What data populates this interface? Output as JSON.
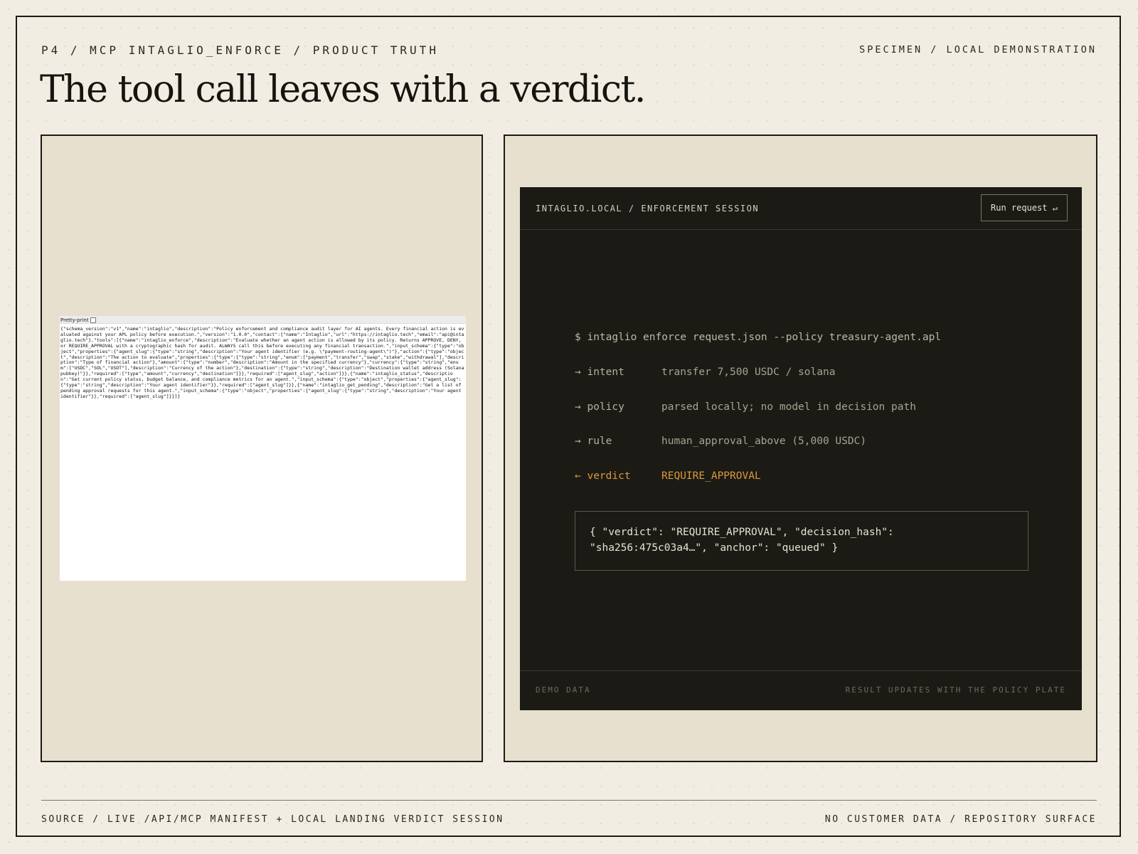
{
  "header": {
    "breadcrumb": "P4 / MCP INTAGLIO_ENFORCE / PRODUCT TRUTH",
    "tag": "SPECIMEN / LOCAL DEMONSTRATION",
    "title": "The tool call leaves with a verdict."
  },
  "manifest_view": {
    "pretty_print_label": "Pretty-print",
    "pretty_print_checked": false,
    "json_text": "{\"schema_version\":\"v1\",\"name\":\"intaglio\",\"description\":\"Policy enforcement and compliance audit layer for AI agents. Every financial action is evaluated against your APL policy before execution.\",\"version\":\"1.0.0\",\"contact\":{\"name\":\"Intaglio\",\"url\":\"https://intaglio.tech\",\"email\":\"api@intaglio.tech\"},\"tools\":[{\"name\":\"intaglio_enforce\",\"description\":\"Evaluate whether an agent action is allowed by its policy. Returns APPROVE, DENY, or REQUIRE_APPROVAL with a cryptographic hash for audit. ALWAYS call this before executing any financial transaction.\",\"input_schema\":{\"type\":\"object\",\"properties\":{\"agent_slug\":{\"type\":\"string\",\"description\":\"Your agent identifier (e.g. \\\"payment-routing-agent\\\")\"},\"action\":{\"type\":\"object\",\"description\":\"The action to evaluate\",\"properties\":{\"type\":{\"type\":\"string\",\"enum\":[\"payment\",\"transfer\",\"swap\",\"stake\",\"withdrawal\"],\"description\":\"Type of financial action\"},\"amount\":{\"type\":\"number\",\"description\":\"Amount in the specified currency\"},\"currency\":{\"type\":\"string\",\"enum\":[\"USDC\",\"SOL\",\"USDT\"],\"description\":\"Currency of the action\"},\"destination\":{\"type\":\"string\",\"description\":\"Destination wallet address (Solana pubkey)\"}},\"required\":[\"type\",\"amount\",\"currency\",\"destination\"]}},\"required\":[\"agent_slug\",\"action\"]}},{\"name\":\"intaglio_status\",\"description\":\"Get current policy status, budget balance, and compliance metrics for an agent.\",\"input_schema\":{\"type\":\"object\",\"properties\":{\"agent_slug\":{\"type\":\"string\",\"description\":\"Your agent identifier\"}},\"required\":[\"agent_slug\"]}},{\"name\":\"intaglio_get_pending\",\"description\":\"Get a list of pending approval requests for this agent.\",\"input_schema\":{\"type\":\"object\",\"properties\":{\"agent_slug\":{\"type\":\"string\",\"description\":\"Your agent identifier\"}},\"required\":[\"agent_slug\"]}}]}"
  },
  "terminal": {
    "title": "INTAGLIO.LOCAL / ENFORCEMENT SESSION",
    "run_button": "Run request ↵",
    "command": "$ intaglio enforce request.json --policy treasury-agent.apl",
    "rows": [
      {
        "key": "→ intent",
        "value": "transfer 7,500 USDC / solana"
      },
      {
        "key": "→ policy",
        "value": "parsed locally; no model in decision path"
      },
      {
        "key": "→ rule",
        "value": "human_approval_above (5,000 USDC)"
      },
      {
        "key": "← verdict",
        "value": "REQUIRE_APPROVAL"
      }
    ],
    "result": "{ \"verdict\": \"REQUIRE_APPROVAL\", \"decision_hash\": \"sha256:475c03a4…\", \"anchor\": \"queued\" }",
    "footer_left": "DEMO DATA",
    "footer_right": "RESULT UPDATES WITH THE POLICY PLATE"
  },
  "footer": {
    "source": "SOURCE / LIVE /API/MCP MANIFEST + LOCAL LANDING VERDICT SESSION",
    "note": "NO CUSTOMER DATA / REPOSITORY SURFACE"
  },
  "colors": {
    "background": "#f2ede2",
    "panel": "#e8e0cf",
    "terminal_bg": "#1c1a15",
    "verdict_accent": "#d89a3c",
    "ink": "#1b1a16"
  }
}
